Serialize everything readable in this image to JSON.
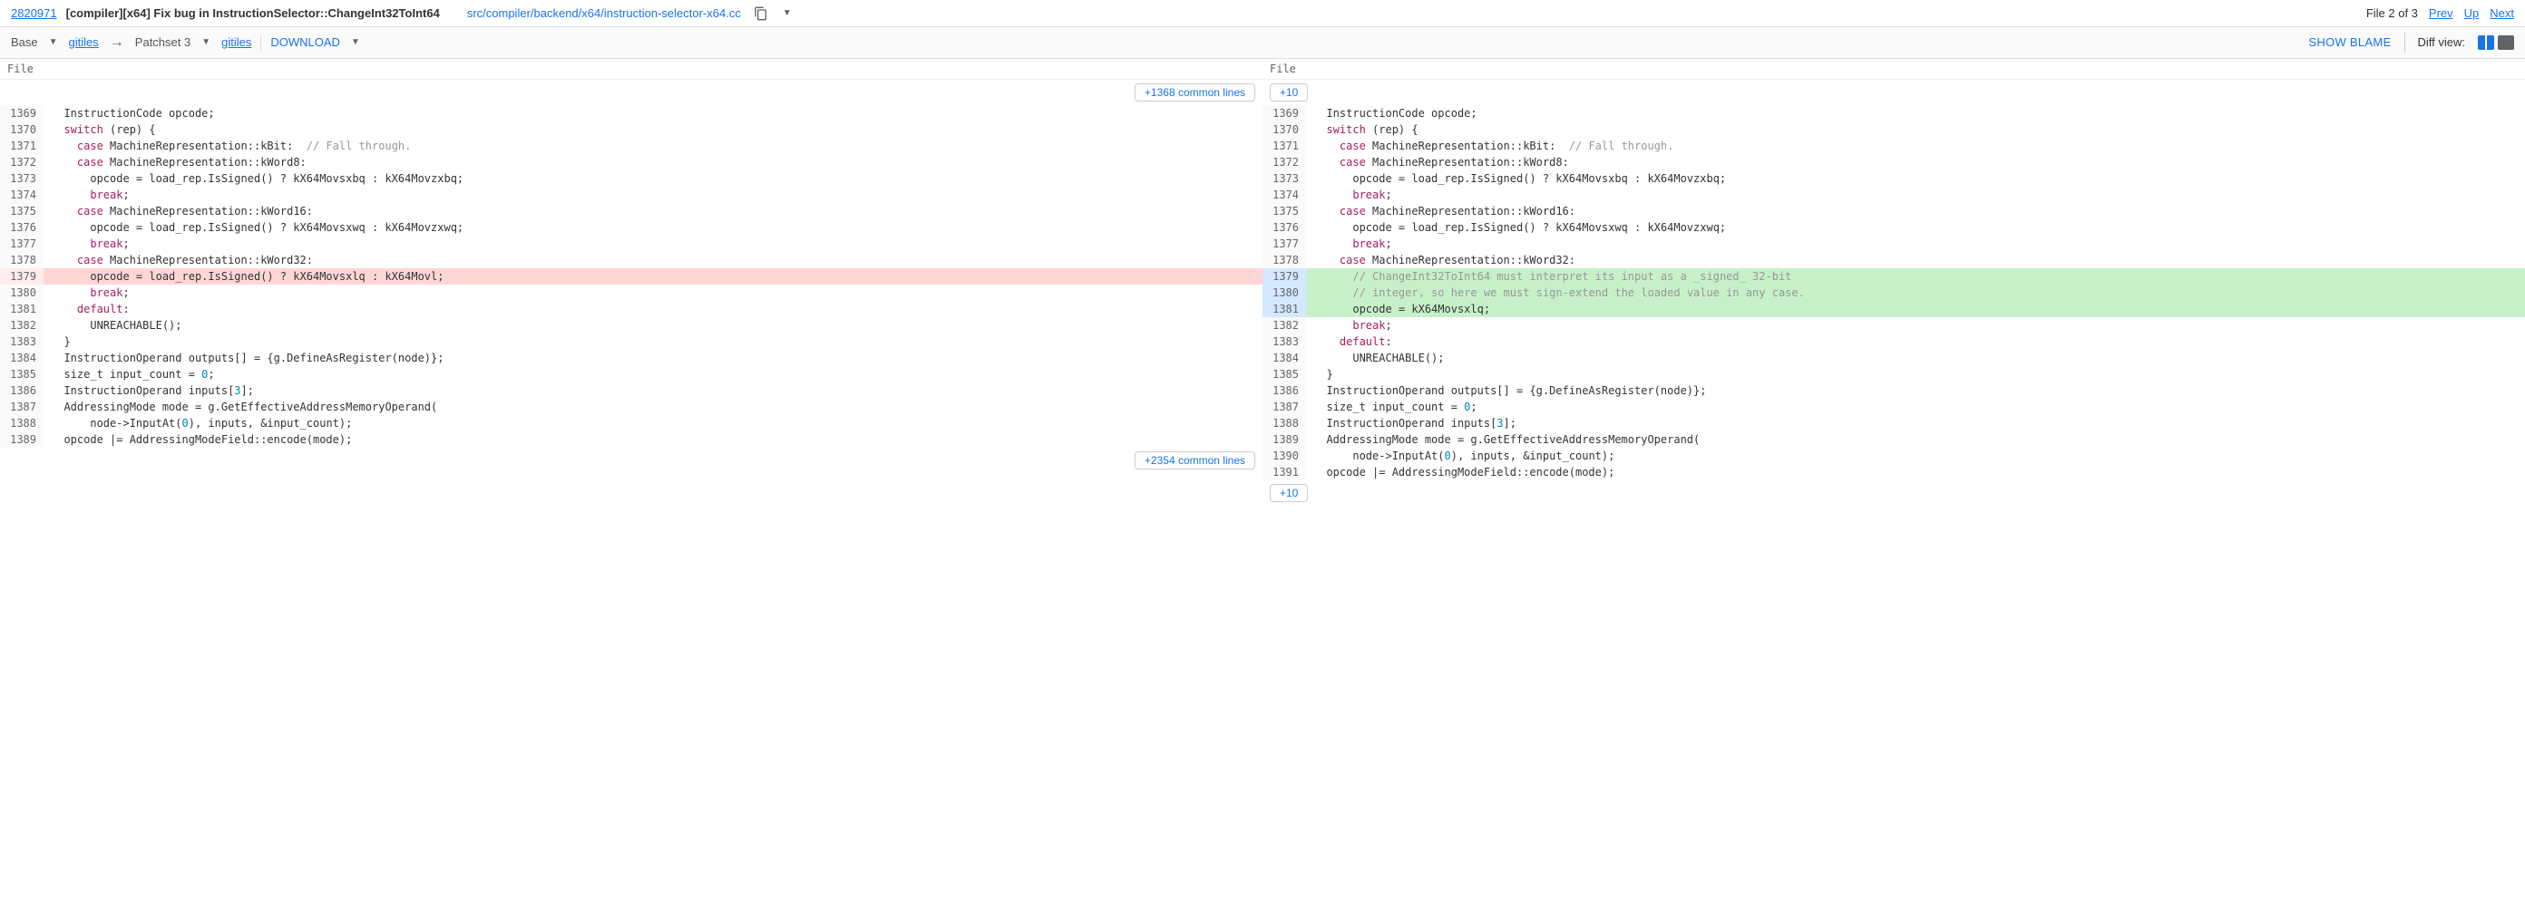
{
  "header": {
    "cl_number": "2820971",
    "cl_title": "[compiler][x64] Fix bug in InstructionSelector::ChangeInt32ToInt64",
    "file_path": "src/compiler/backend/x64/instruction-selector-x64.cc",
    "file_counter": "File 2 of 3",
    "prev": "Prev",
    "up": "Up",
    "next": "Next"
  },
  "subheader": {
    "base": "Base",
    "gitiles_left": "gitiles",
    "arrow": "→",
    "patchset": "Patchset 3",
    "gitiles_right": "gitiles",
    "download": "DOWNLOAD",
    "show_blame": "SHOW BLAME",
    "diff_view": "Diff view:"
  },
  "pane": {
    "file_label": "File"
  },
  "expand_top": {
    "common": "+1368 common lines",
    "plus10": "+10"
  },
  "expand_bottom": {
    "common": "+2354 common lines",
    "plus10": "+10"
  },
  "left_lines": [
    {
      "n": "1369",
      "html": "  InstructionCode opcode;"
    },
    {
      "n": "1370",
      "html": "  <span class='kw'>switch</span> (rep) {"
    },
    {
      "n": "1371",
      "html": "    <span class='kw'>case</span> MachineRepresentation::kBit:  <span class='com'>// Fall through.</span>"
    },
    {
      "n": "1372",
      "html": "    <span class='kw'>case</span> MachineRepresentation::kWord8:"
    },
    {
      "n": "1373",
      "html": "      opcode = load_rep.IsSigned() ? kX64Movsxbq : kX64Movzxbq;"
    },
    {
      "n": "1374",
      "html": "      <span class='kw'>break</span>;"
    },
    {
      "n": "1375",
      "html": "    <span class='kw'>case</span> MachineRepresentation::kWord16:"
    },
    {
      "n": "1376",
      "html": "      opcode = load_rep.IsSigned() ? kX64Movsxwq : kX64Movzxwq;"
    },
    {
      "n": "1377",
      "html": "      <span class='kw'>break</span>;"
    },
    {
      "n": "1378",
      "html": "    <span class='kw'>case</span> MachineRepresentation::kWord32:"
    },
    {
      "n": "1379",
      "html": "      opcode = load_rep.IsSigned() ? kX64Movsxlq : kX64Movl;",
      "cls": "line-removed"
    },
    {
      "n": "",
      "html": "",
      "cls": "line-blank"
    },
    {
      "n": "",
      "html": "",
      "cls": "line-blank"
    },
    {
      "n": "1380",
      "html": "      <span class='kw'>break</span>;"
    },
    {
      "n": "1381",
      "html": "    <span class='kw'>default</span>:"
    },
    {
      "n": "1382",
      "html": "      UNREACHABLE();"
    },
    {
      "n": "1383",
      "html": "  }"
    },
    {
      "n": "1384",
      "html": "  InstructionOperand outputs[] = {g.DefineAsRegister(node)};"
    },
    {
      "n": "1385",
      "html": "  size_t input_count = <span class='num'>0</span>;"
    },
    {
      "n": "1386",
      "html": "  InstructionOperand inputs[<span class='num'>3</span>];"
    },
    {
      "n": "1387",
      "html": "  AddressingMode mode = g.GetEffectiveAddressMemoryOperand("
    },
    {
      "n": "1388",
      "html": "      node->InputAt(<span class='num'>0</span>), inputs, &input_count);"
    },
    {
      "n": "1389",
      "html": "  opcode |= AddressingModeField::encode(mode);"
    }
  ],
  "right_lines": [
    {
      "n": "1369",
      "html": "  InstructionCode opcode;"
    },
    {
      "n": "1370",
      "html": "  <span class='kw'>switch</span> (rep) {"
    },
    {
      "n": "1371",
      "html": "    <span class='kw'>case</span> MachineRepresentation::kBit:  <span class='com'>// Fall through.</span>"
    },
    {
      "n": "1372",
      "html": "    <span class='kw'>case</span> MachineRepresentation::kWord8:"
    },
    {
      "n": "1373",
      "html": "      opcode = load_rep.IsSigned() ? kX64Movsxbq : kX64Movzxbq;"
    },
    {
      "n": "1374",
      "html": "      <span class='kw'>break</span>;"
    },
    {
      "n": "1375",
      "html": "    <span class='kw'>case</span> MachineRepresentation::kWord16:"
    },
    {
      "n": "1376",
      "html": "      opcode = load_rep.IsSigned() ? kX64Movsxwq : kX64Movzxwq;"
    },
    {
      "n": "1377",
      "html": "      <span class='kw'>break</span>;"
    },
    {
      "n": "1378",
      "html": "    <span class='kw'>case</span> MachineRepresentation::kWord32:"
    },
    {
      "n": "1379",
      "html": "      <span class='com'>// ChangeInt32ToInt64 must interpret its input as a _signed_ 32-bit</span>",
      "cls": "line-added"
    },
    {
      "n": "1380",
      "html": "      <span class='com'>// integer, so here we must sign-extend the loaded value in any case.</span>",
      "cls": "line-added"
    },
    {
      "n": "1381",
      "html": "      opcode = kX64Movsxlq;",
      "cls": "line-added"
    },
    {
      "n": "1382",
      "html": "      <span class='kw'>break</span>;"
    },
    {
      "n": "1383",
      "html": "    <span class='kw'>default</span>:"
    },
    {
      "n": "1384",
      "html": "      UNREACHABLE();"
    },
    {
      "n": "1385",
      "html": "  }"
    },
    {
      "n": "1386",
      "html": "  InstructionOperand outputs[] = {g.DefineAsRegister(node)};"
    },
    {
      "n": "1387",
      "html": "  size_t input_count = <span class='num'>0</span>;"
    },
    {
      "n": "1388",
      "html": "  InstructionOperand inputs[<span class='num'>3</span>];"
    },
    {
      "n": "1389",
      "html": "  AddressingMode mode = g.GetEffectiveAddressMemoryOperand("
    },
    {
      "n": "1390",
      "html": "      node->InputAt(<span class='num'>0</span>), inputs, &input_count);"
    },
    {
      "n": "1391",
      "html": "  opcode |= AddressingModeField::encode(mode);"
    }
  ]
}
